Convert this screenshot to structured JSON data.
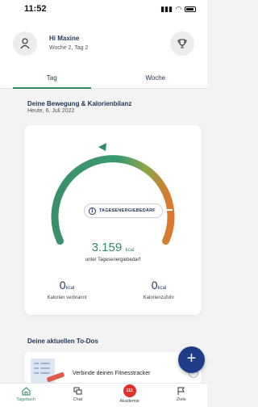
{
  "status": {
    "time": "11:52"
  },
  "header": {
    "greeting": "Hi Maxine",
    "subtitle": "Woche 2, Tag 2"
  },
  "tabs": [
    {
      "label": "Tag",
      "active": true
    },
    {
      "label": "Woche",
      "active": false
    }
  ],
  "section": {
    "title": "Deine Bewegung & Kalorienbilanz",
    "date": "Heute, 6. Juli 2022"
  },
  "gauge": {
    "pill_label": "TAGESENERGIEBEDARF",
    "value": "3.159",
    "value_unit": "kcal",
    "value_caption": "unter Tagesenergiebedarf"
  },
  "stats": [
    {
      "value": "0",
      "unit": "kcal",
      "label": "Kalorien verbrannt"
    },
    {
      "value": "0",
      "unit": "kcal",
      "label": "Kalorienzufuhr"
    }
  ],
  "todos": {
    "title": "Deine aktuellen To-Dos",
    "items": [
      {
        "text": "Verbinde deinen Fitnesstracker"
      }
    ]
  },
  "fab": {
    "label": "+"
  },
  "nav": [
    {
      "label": "Tagebuch",
      "icon": "home-icon",
      "active": true
    },
    {
      "label": "Chat",
      "icon": "chat-icon",
      "active": false
    },
    {
      "label": "Akademie",
      "icon": "badge",
      "badge": "111",
      "active": false
    },
    {
      "label": "Ziele",
      "icon": "flag-icon",
      "active": false
    }
  ],
  "colors": {
    "accent": "#2e8c63",
    "navy": "#1d3557",
    "fab": "#1f3c88",
    "badge": "#e0302a",
    "gauge_end": "#e0762d"
  }
}
